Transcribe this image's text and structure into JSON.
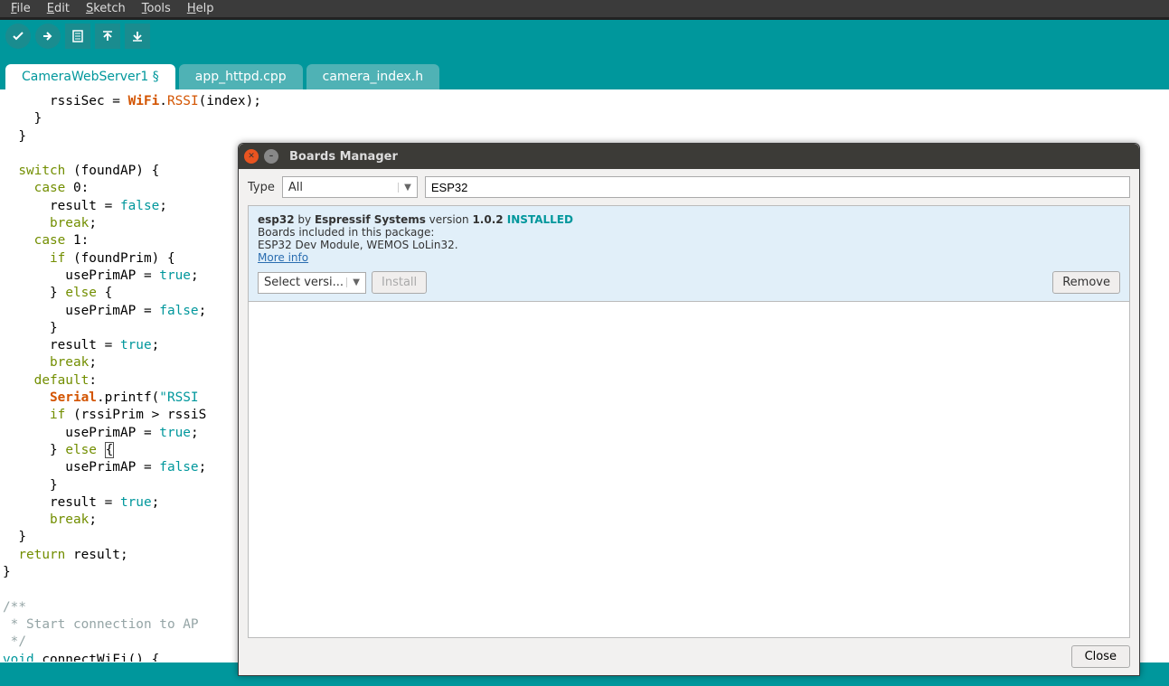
{
  "menu": {
    "file": "File",
    "edit": "Edit",
    "sketch": "Sketch",
    "tools": "Tools",
    "help": "Help"
  },
  "tabs": {
    "t1": "CameraWebServer1 §",
    "t2": "app_httpd.cpp",
    "t3": "camera_index.h"
  },
  "code": {
    "l00a": "      rssiSec = ",
    "l00b": "WiFi",
    "l00c": ".",
    "l00d": "RSSI",
    "l00e": "(index);",
    "l01": "    }",
    "l02": "  }",
    "l03": "",
    "l04a": "  ",
    "l04b": "switch",
    "l04c": " (foundAP) {",
    "l05a": "    ",
    "l05b": "case",
    "l05c": " 0:",
    "l06a": "      result = ",
    "l06b": "false",
    "l06c": ";",
    "l07a": "      ",
    "l07b": "break",
    "l07c": ";",
    "l08a": "    ",
    "l08b": "case",
    "l08c": " 1:",
    "l09a": "      ",
    "l09b": "if",
    "l09c": " (foundPrim) {",
    "l10a": "        usePrimAP = ",
    "l10b": "true",
    "l10c": ";",
    "l11a": "      } ",
    "l11b": "else",
    "l11c": " {",
    "l12a": "        usePrimAP = ",
    "l12b": "false",
    "l12c": ";",
    "l13": "      }",
    "l14a": "      result = ",
    "l14b": "true",
    "l14c": ";",
    "l15a": "      ",
    "l15b": "break",
    "l15c": ";",
    "l16a": "    ",
    "l16b": "default",
    "l16c": ":",
    "l17a": "      ",
    "l17b": "Serial",
    "l17c": ".printf(",
    "l17d": "\"RSSI",
    "l18a": "      ",
    "l18b": "if",
    "l18c": " (rssiPrim > rssiS",
    "l19a": "        usePrimAP = ",
    "l19b": "true",
    "l19c": ";",
    "l20a": "      } ",
    "l20b": "else",
    "l20c": " ",
    "l20d": "{",
    "l21a": "        usePrimAP = ",
    "l21b": "false",
    "l21c": ";",
    "l22": "      }",
    "l23a": "      result = ",
    "l23b": "true",
    "l23c": ";",
    "l24a": "      ",
    "l24b": "break",
    "l24c": ";",
    "l25": "  }",
    "l26a": "  ",
    "l26b": "return",
    "l26c": " result;",
    "l27": "}",
    "l28": "",
    "l29": "/**",
    "l30": " * Start connection to AP",
    "l31": " */",
    "l32a": "void",
    "l32b": " connectWiFi() {"
  },
  "dialog": {
    "title": "Boards Manager",
    "type_label": "Type",
    "type_value": "All",
    "search_value": "ESP32",
    "pkg_name": "esp32",
    "by": " by ",
    "vendor": "Espressif Systems",
    "version_label": " version ",
    "version": "1.0.2",
    "installed": " INSTALLED",
    "included_label": "Boards included in this package:",
    "included": "ESP32 Dev Module, WEMOS LoLin32.",
    "more_info": "More info",
    "select_version": "Select versi...",
    "install": "Install",
    "remove": "Remove",
    "close": "Close"
  }
}
